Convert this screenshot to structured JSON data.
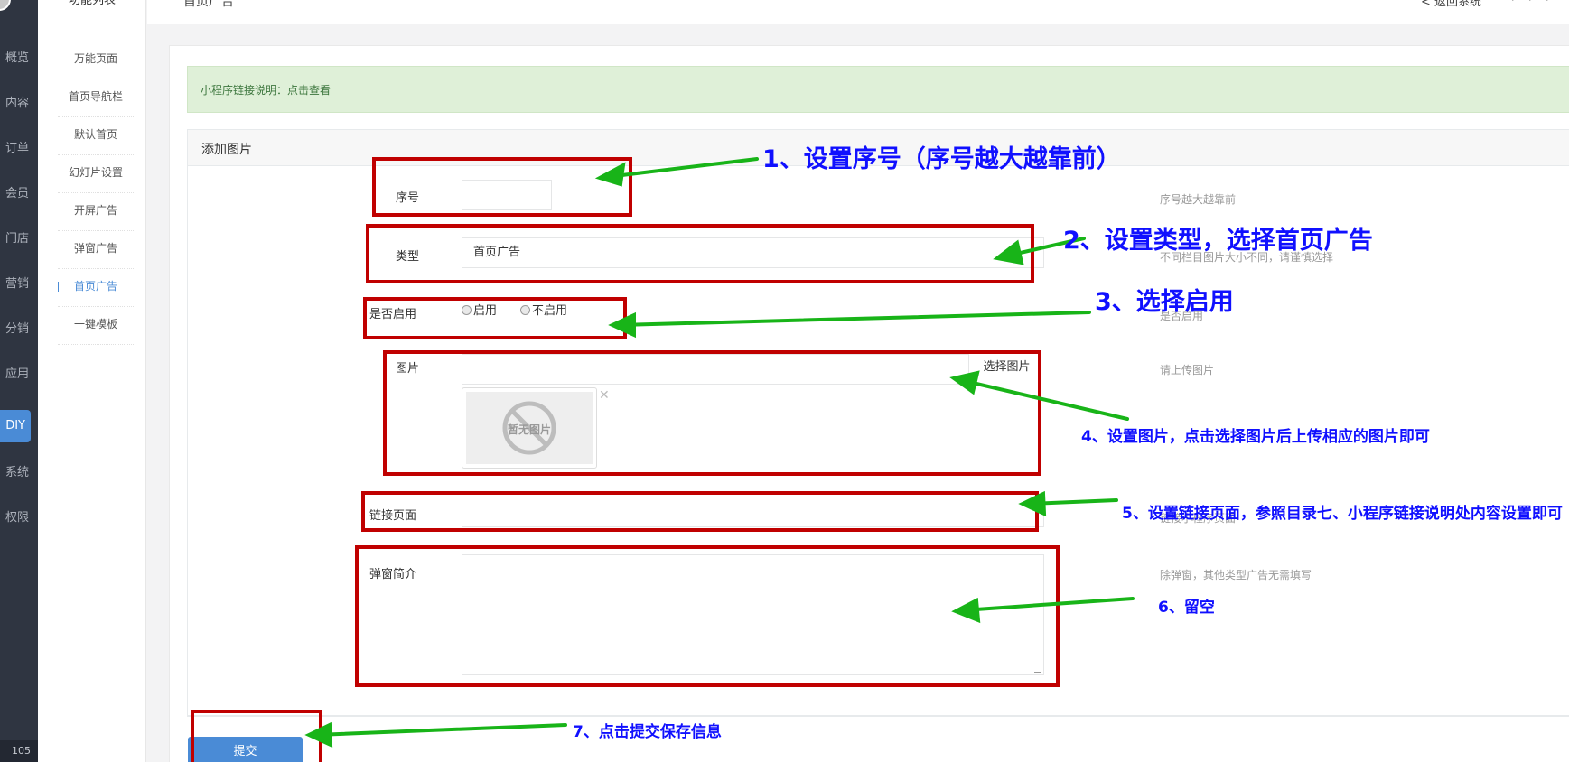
{
  "rail": {
    "items": [
      {
        "label": "概览"
      },
      {
        "label": "内容"
      },
      {
        "label": "订单"
      },
      {
        "label": "会员"
      },
      {
        "label": "门店"
      },
      {
        "label": "营销"
      },
      {
        "label": "分销"
      },
      {
        "label": "应用"
      },
      {
        "label": "DIY",
        "active": true
      },
      {
        "label": "系统"
      },
      {
        "label": "权限"
      }
    ],
    "version": "105"
  },
  "submenu": {
    "title": "功能列表",
    "items": [
      {
        "label": "万能页面"
      },
      {
        "label": "首页导航栏"
      },
      {
        "label": "默认首页"
      },
      {
        "label": "幻灯片设置"
      },
      {
        "label": "开屏广告"
      },
      {
        "label": "弹窗广告"
      },
      {
        "label": "首页广告",
        "active": true
      },
      {
        "label": "一键模板"
      }
    ]
  },
  "header": {
    "breadcrumb": "首页广告",
    "back_link": "< 返回系统"
  },
  "notice": {
    "text": "小程序链接说明：点击查看"
  },
  "panel": {
    "title": "添加图片"
  },
  "form": {
    "sort": {
      "label": "序号",
      "value": "",
      "help": "序号越大越靠前"
    },
    "type": {
      "label": "类型",
      "value": "首页广告",
      "help": "不同栏目图片大小不同，请谨慎选择"
    },
    "enabled": {
      "label": "是否启用",
      "option_on": "启用",
      "option_off": "不启用",
      "help": "是否启用"
    },
    "image": {
      "label": "图片",
      "value": "",
      "button": "选择图片",
      "placeholder": "暂无图片",
      "help": "请上传图片"
    },
    "link": {
      "label": "链接页面",
      "value": "",
      "help": "链接小程序页面"
    },
    "intro": {
      "label": "弹窗简介",
      "value": "",
      "help": "除弹窗，其他类型广告无需填写"
    },
    "submit": "提交"
  },
  "annotations": {
    "step1": "1、设置序号（序号越大越靠前）",
    "step2": "2、设置类型，选择首页广告",
    "step3": "3、选择启用",
    "step4": "4、设置图片，点击选择图片后上传相应的图片即可",
    "step5": "5、设置链接页面，参照目录七、小程序链接说明处内容设置即可",
    "step6": "6、留空",
    "step7": "7、点击提交保存信息"
  },
  "colors": {
    "rail_bg": "#2f3541",
    "accent": "#4a8bd6",
    "notice_bg": "#dff0d8",
    "annotation_box": "#c00000",
    "annotation_arrow": "#18b418",
    "annotation_text": "#1010ff"
  }
}
